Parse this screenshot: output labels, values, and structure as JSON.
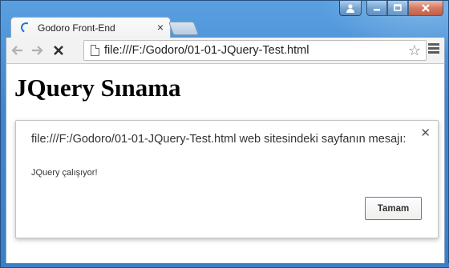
{
  "window": {
    "caption_buttons": {
      "user": "user-icon",
      "minimize": "minimize-icon",
      "maximize": "maximize-icon",
      "close": "close-icon"
    }
  },
  "tabs": [
    {
      "title": "Godoro Front-End",
      "loading": true
    }
  ],
  "toolbar": {
    "back_icon": "back-arrow-icon",
    "forward_icon": "forward-arrow-icon",
    "stop_icon": "stop-icon",
    "address": "file:///F:/Godoro/01-01-JQuery-Test.html"
  },
  "page": {
    "heading": "JQuery Sınama"
  },
  "dialog": {
    "title": "file:///F:/Godoro/01-01-JQuery-Test.html web sitesindeki sayfanın mesajı:",
    "message": "JQuery çalışıyor!",
    "ok_label": "Tamam"
  },
  "colors": {
    "frame": "#3f86cf",
    "accent": "#4d7ad0",
    "spinner": "#1c74d8"
  }
}
